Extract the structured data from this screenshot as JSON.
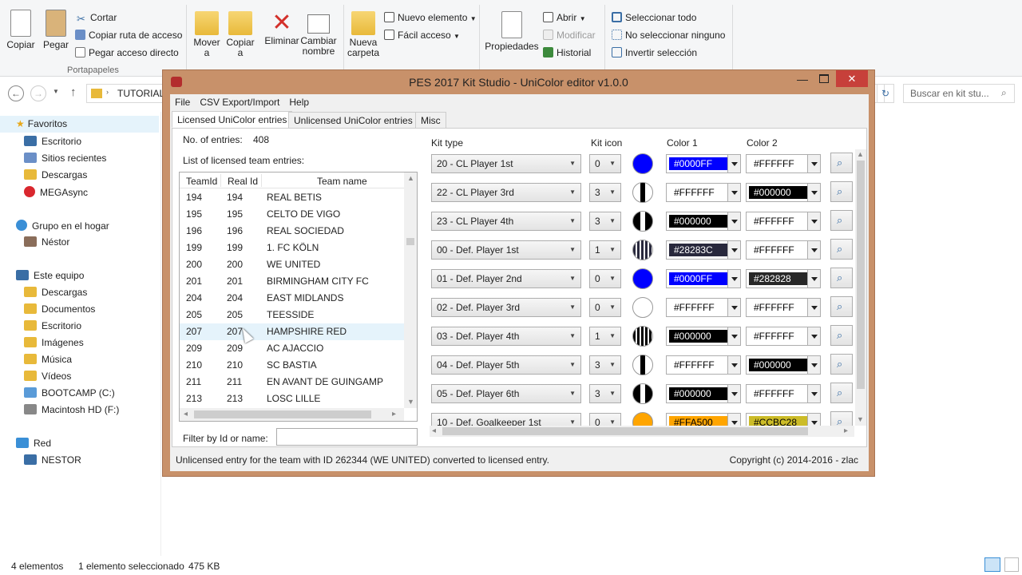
{
  "ribbon": {
    "clipboard": {
      "copy": "Copiar",
      "paste": "Pegar",
      "cut": "Cortar",
      "copy_path": "Copiar ruta de acceso",
      "paste_shortcut": "Pegar acceso directo",
      "label": "Portapapeles"
    },
    "organize": {
      "move": "Mover a",
      "copy_to": "Copiar a",
      "delete": "Eliminar",
      "rename": "Cambiar nombre"
    },
    "new": {
      "new_folder": "Nueva carpeta",
      "new_item": "Nuevo elemento",
      "easy_access": "Fácil acceso"
    },
    "open": {
      "properties": "Propiedades",
      "open": "Abrir",
      "modify": "Modificar",
      "history": "Historial"
    },
    "select": {
      "select_all": "Seleccionar todo",
      "select_none": "No seleccionar ninguno",
      "invert": "Invertir selección"
    }
  },
  "addressbar": {
    "path": "TUTORIAL",
    "search_placeholder": "Buscar en kit stu..."
  },
  "nav": {
    "favorites": "Favoritos",
    "fav_items": [
      "Escritorio",
      "Sitios recientes",
      "Descargas",
      "MEGAsync"
    ],
    "homegroup": "Grupo en el hogar",
    "homegroup_user": "Néstor",
    "this_pc": "Este equipo",
    "pc_items": [
      "Descargas",
      "Documentos",
      "Escritorio",
      "Imágenes",
      "Música",
      "Vídeos",
      "BOOTCAMP (C:)",
      "Macintosh HD (F:)"
    ],
    "network": "Red",
    "network_items": [
      "NESTOR"
    ]
  },
  "explorer_status": {
    "count": "4 elementos",
    "selected": "1 elemento seleccionado",
    "size": "475 KB"
  },
  "app": {
    "title": "PES 2017 Kit Studio - UniColor editor v1.0.0",
    "menu": [
      "File",
      "CSV Export/Import",
      "Help"
    ],
    "tabs": [
      "Licensed UniColor entries",
      "Unlicensed UniColor entries",
      "Misc"
    ],
    "entries_label": "No. of entries:",
    "entries_value": "408",
    "list_label": "List of licensed team entries:",
    "columns": [
      "TeamId",
      "Real Id",
      "Team name"
    ],
    "rows": [
      [
        "194",
        "194",
        "REAL BETIS"
      ],
      [
        "195",
        "195",
        "CELTO DE VIGO"
      ],
      [
        "196",
        "196",
        "REAL SOCIEDAD"
      ],
      [
        "199",
        "199",
        "1. FC KÖLN"
      ],
      [
        "200",
        "200",
        "WE UNITED"
      ],
      [
        "201",
        "201",
        "BIRMINGHAM CITY FC"
      ],
      [
        "204",
        "204",
        "EAST MIDLANDS"
      ],
      [
        "205",
        "205",
        "TEESSIDE"
      ],
      [
        "207",
        "207",
        "HAMPSHIRE RED"
      ],
      [
        "209",
        "209",
        "AC AJACCIO"
      ],
      [
        "210",
        "210",
        "SC BASTIA"
      ],
      [
        "211",
        "211",
        "EN AVANT DE GUINGAMP"
      ],
      [
        "213",
        "213",
        "LOSC LILLE"
      ]
    ],
    "filter_label": "Filter by Id or name:",
    "filter_value": "",
    "kit_headers": {
      "kit_type": "Kit type",
      "kit_icon": "Kit icon",
      "color1": "Color 1",
      "color2": "Color 2"
    },
    "kits": [
      {
        "type": "20 - CL Player 1st",
        "icon": "0",
        "pattern": "solid",
        "pcolor": "#0000FF",
        "c1": "#0000FF",
        "c1bg": "#0000FF",
        "c1fg": "#FFFFFF",
        "c2": "#FFFFFF",
        "c2bg": "#FFFFFF",
        "c2fg": "#000000"
      },
      {
        "type": "22 - CL Player 3rd",
        "icon": "3",
        "pattern": "center",
        "pcolor": "#FFFFFF",
        "c1": "#FFFFFF",
        "c1bg": "#FFFFFF",
        "c1fg": "#000000",
        "c2": "#000000",
        "c2bg": "#000000",
        "c2fg": "#FFFFFF"
      },
      {
        "type": "23 - CL Player 4th",
        "icon": "3",
        "pattern": "center",
        "pcolor": "#000000",
        "c1": "#000000",
        "c1bg": "#000000",
        "c1fg": "#FFFFFF",
        "c2": "#FFFFFF",
        "c2bg": "#FFFFFF",
        "c2fg": "#000000"
      },
      {
        "type": "00 - Def. Player 1st",
        "icon": "1",
        "pattern": "stripes",
        "pcolor": "#28283C",
        "c1": "#28283C",
        "c1bg": "#28283C",
        "c1fg": "#FFFFFF",
        "c2": "#FFFFFF",
        "c2bg": "#FFFFFF",
        "c2fg": "#000000"
      },
      {
        "type": "01 - Def. Player 2nd",
        "icon": "0",
        "pattern": "solid",
        "pcolor": "#0000FF",
        "c1": "#0000FF",
        "c1bg": "#0000FF",
        "c1fg": "#FFFFFF",
        "c2": "#282828",
        "c2bg": "#282828",
        "c2fg": "#FFFFFF"
      },
      {
        "type": "02 - Def. Player 3rd",
        "icon": "0",
        "pattern": "solid",
        "pcolor": "#FFFFFF",
        "c1": "#FFFFFF",
        "c1bg": "#FFFFFF",
        "c1fg": "#000000",
        "c2": "#FFFFFF",
        "c2bg": "#FFFFFF",
        "c2fg": "#000000"
      },
      {
        "type": "03 - Def. Player 4th",
        "icon": "1",
        "pattern": "stripes",
        "pcolor": "#000000",
        "c1": "#000000",
        "c1bg": "#000000",
        "c1fg": "#FFFFFF",
        "c2": "#FFFFFF",
        "c2bg": "#FFFFFF",
        "c2fg": "#000000"
      },
      {
        "type": "04 - Def. Player 5th",
        "icon": "3",
        "pattern": "center",
        "pcolor": "#FFFFFF",
        "c1": "#FFFFFF",
        "c1bg": "#FFFFFF",
        "c1fg": "#000000",
        "c2": "#000000",
        "c2bg": "#000000",
        "c2fg": "#FFFFFF"
      },
      {
        "type": "05 - Def. Player 6th",
        "icon": "3",
        "pattern": "center",
        "pcolor": "#000000",
        "c1": "#000000",
        "c1bg": "#000000",
        "c1fg": "#FFFFFF",
        "c2": "#FFFFFF",
        "c2bg": "#FFFFFF",
        "c2fg": "#000000"
      },
      {
        "type": "10 - Def. Goalkeeper 1st",
        "icon": "0",
        "pattern": "solid",
        "pcolor": "#FFA500",
        "c1": "#FFA500",
        "c1bg": "#FFA500",
        "c1fg": "#000000",
        "c2": "#CCBC28",
        "c2bg": "#CCBC28",
        "c2fg": "#000000"
      }
    ],
    "status_left": "Unlicensed entry for the team with ID 262344 (WE UNITED) converted to licensed entry.",
    "status_right": "Copyright (c) 2014-2016 - zlac"
  }
}
